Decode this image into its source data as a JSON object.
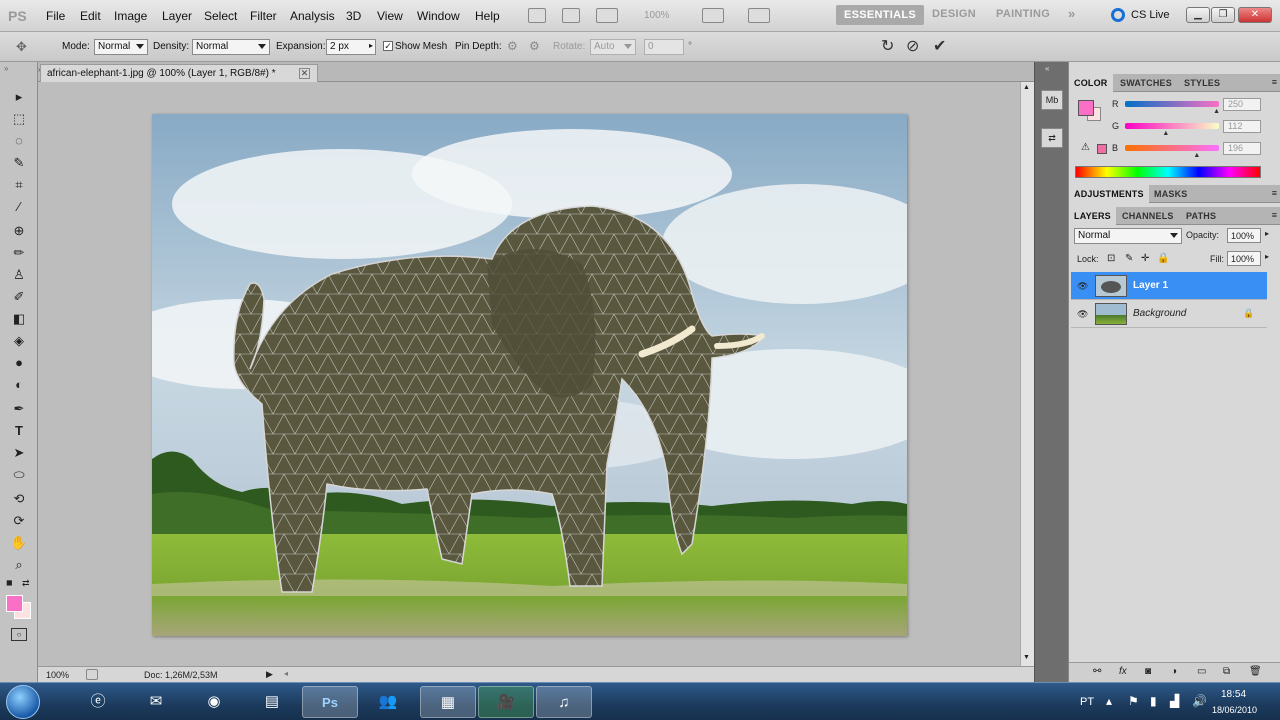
{
  "app": {
    "logo": "PS",
    "menu": [
      "File",
      "Edit",
      "Image",
      "Layer",
      "Select",
      "Filter",
      "Analysis",
      "3D",
      "View",
      "Window",
      "Help"
    ],
    "zoom_combo": "100%",
    "workspaces": [
      "ESSENTIALS",
      "DESIGN",
      "PAINTING"
    ],
    "workspace_more": "»",
    "cslive": "CS Live"
  },
  "options": {
    "mode_label": "Mode:",
    "mode_value": "Normal",
    "density_label": "Density:",
    "density_value": "Normal",
    "expansion_label": "Expansion:",
    "expansion_value": "2 px",
    "show_mesh_label": "Show Mesh",
    "pin_depth_label": "Pin Depth:",
    "rotate_label": "Rotate:",
    "rotate_value": "Auto",
    "angle_value": "0",
    "angle_unit": "°"
  },
  "document": {
    "tab_title": "african-elephant-1.jpg @ 100% (Layer 1, RGB/8#) *",
    "zoom": "100%",
    "doc_info": "Doc: 1,26M/2,53M"
  },
  "color_panel": {
    "tabs": [
      "COLOR",
      "SWATCHES",
      "STYLES"
    ],
    "foreground": "#fa70c4",
    "channels": [
      {
        "name": "R",
        "value": "250",
        "track_color": "#e37ac9",
        "fraction": 0.98
      },
      {
        "name": "G",
        "value": "112",
        "track_color": "#f06ed0",
        "fraction": 0.44
      },
      {
        "name": "B",
        "value": "196",
        "track_color": "#f47ba0",
        "fraction": 0.77
      }
    ]
  },
  "adjustments_tabs": [
    "ADJUSTMENTS",
    "MASKS"
  ],
  "layers_panel": {
    "tabs": [
      "LAYERS",
      "CHANNELS",
      "PATHS"
    ],
    "blend_mode": "Normal",
    "opacity_label": "Opacity:",
    "opacity_value": "100%",
    "lock_label": "Lock:",
    "fill_label": "Fill:",
    "fill_value": "100%",
    "layers": [
      {
        "name": "Layer 1",
        "selected": true
      },
      {
        "name": "Background",
        "selected": false,
        "locked": true
      }
    ]
  },
  "taskbar": {
    "lang": "PT",
    "time": "18:54",
    "date": "18/06/2010"
  }
}
